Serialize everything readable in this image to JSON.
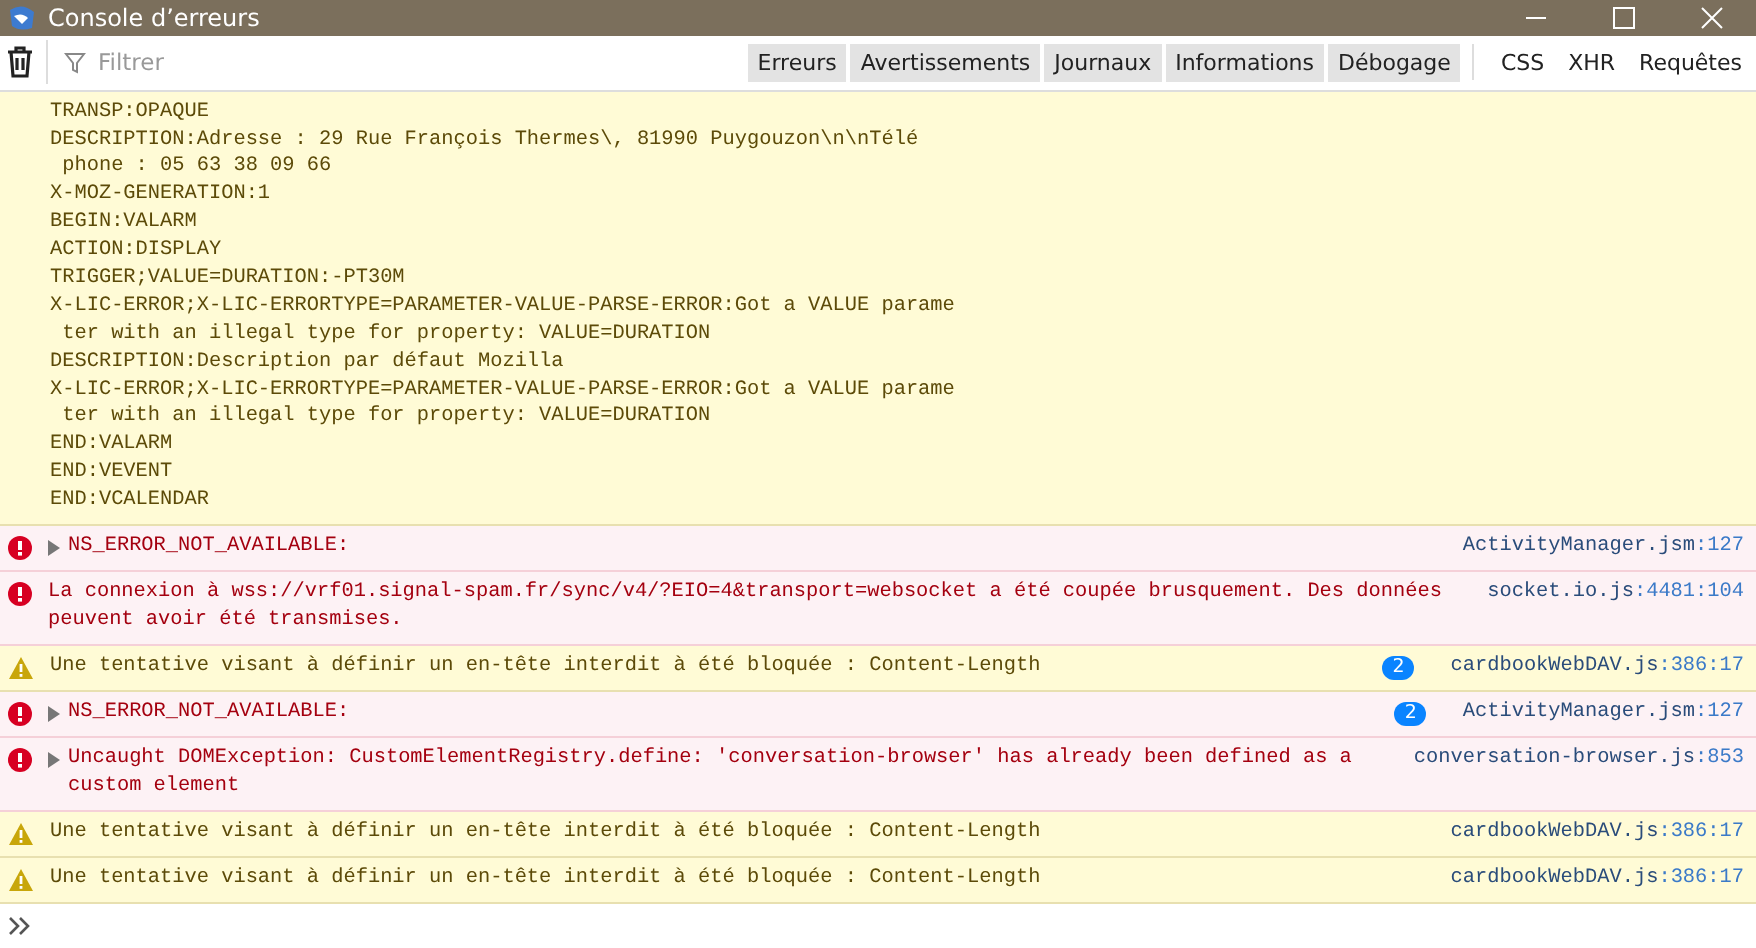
{
  "window": {
    "title": "Console d’erreurs"
  },
  "toolbar": {
    "filter_placeholder": "Filtrer",
    "levels": [
      {
        "label": "Erreurs",
        "selected": true
      },
      {
        "label": "Avertissements",
        "selected": true
      },
      {
        "label": "Journaux",
        "selected": true
      },
      {
        "label": "Informations",
        "selected": true
      },
      {
        "label": "Débogage",
        "selected": true
      }
    ],
    "types": [
      {
        "label": "CSS",
        "selected": false
      },
      {
        "label": "XHR",
        "selected": false
      },
      {
        "label": "Requêtes",
        "selected": false
      }
    ]
  },
  "log_block": {
    "lines": [
      "TRANSP:OPAQUE",
      "DESCRIPTION:Adresse : 29 Rue François Thermes\\, 81990 Puygouzon\\n\\nTélé",
      " phone : 05 63 38 09 66",
      "X-MOZ-GENERATION:1",
      "BEGIN:VALARM",
      "ACTION:DISPLAY",
      "TRIGGER;VALUE=DURATION:-PT30M",
      "X-LIC-ERROR;X-LIC-ERRORTYPE=PARAMETER-VALUE-PARSE-ERROR:Got a VALUE parame",
      " ter with an illegal type for property: VALUE=DURATION",
      "DESCRIPTION:Description par défaut Mozilla",
      "X-LIC-ERROR;X-LIC-ERRORTYPE=PARAMETER-VALUE-PARSE-ERROR:Got a VALUE parame",
      " ter with an illegal type for property: VALUE=DURATION",
      "END:VALARM",
      "END:VEVENT",
      "END:VCALENDAR"
    ]
  },
  "messages": [
    {
      "kind": "error",
      "expandable": true,
      "text": "NS_ERROR_NOT_AVAILABLE:",
      "file": "ActivityManager.jsm",
      "location": ":127"
    },
    {
      "kind": "error",
      "expandable": false,
      "text": "La connexion à wss://vrf01.signal-spam.fr/sync/v4/?EIO=4&transport=websocket a été coupée brusquement. Des données peuvent avoir été transmises.",
      "file": "socket.io.js",
      "location": ":4481:104"
    },
    {
      "kind": "warning",
      "expandable": false,
      "text": "Une tentative visant à définir un en-tête interdit à été bloquée : Content-Length",
      "count": "2",
      "file": "cardbookWebDAV.js",
      "location": ":386:17"
    },
    {
      "kind": "error",
      "expandable": true,
      "text": "NS_ERROR_NOT_AVAILABLE:",
      "count": "2",
      "file": "ActivityManager.jsm",
      "location": ":127"
    },
    {
      "kind": "error",
      "expandable": true,
      "text": "Uncaught DOMException: CustomElementRegistry.define: 'conversation-browser' has already been defined as a custom element",
      "file": "conversation-browser.js",
      "location": ":853"
    },
    {
      "kind": "warning",
      "expandable": false,
      "text": "Une tentative visant à définir un en-tête interdit à été bloquée : Content-Length",
      "file": "cardbookWebDAV.js",
      "location": ":386:17"
    },
    {
      "kind": "warning",
      "expandable": false,
      "text": "Une tentative visant à définir un en-tête interdit à été bloquée : Content-Length",
      "file": "cardbookWebDAV.js",
      "location": ":386:17"
    }
  ]
}
